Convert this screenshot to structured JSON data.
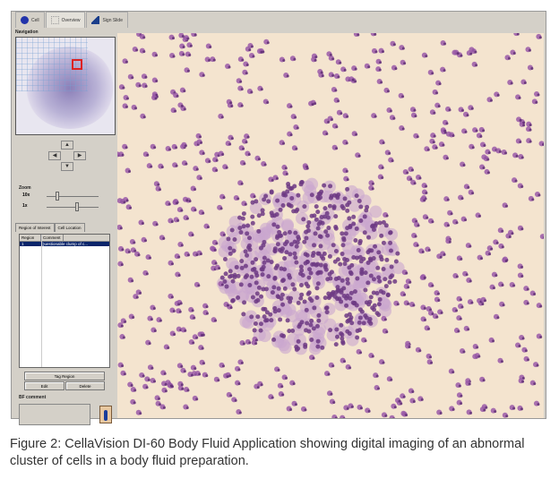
{
  "tabs": [
    {
      "label": "Cell",
      "icon": "cell-icon"
    },
    {
      "label": "Overview",
      "icon": "overview-icon"
    },
    {
      "label": "Sign Slide",
      "icon": "sign-slide-icon"
    }
  ],
  "navigation": {
    "label": "Navigation"
  },
  "zoom": {
    "label": "Zoom",
    "levels": [
      "10x",
      "1x"
    ],
    "values": [
      0.2,
      0.55
    ]
  },
  "roi": {
    "tabs": [
      "Region of Interest",
      "Cell Location"
    ],
    "columns": [
      "Region",
      "Comment"
    ],
    "rows": [
      {
        "region": "1",
        "comment": "Questionable clump of c..."
      }
    ]
  },
  "buttons": {
    "tag": "Tag Region",
    "edit": "Edit",
    "delete": "Delete"
  },
  "bf_comment": {
    "label": "BF comment",
    "value": ""
  },
  "colors": {
    "background": "#f4e4cf",
    "cell": "#9a5aa8",
    "selection": "#0a246a"
  },
  "caption": "Figure 2: CellaVision DI-60 Body Fluid Application showing digital imaging of an abnormal cluster of cells in a body fluid preparation."
}
